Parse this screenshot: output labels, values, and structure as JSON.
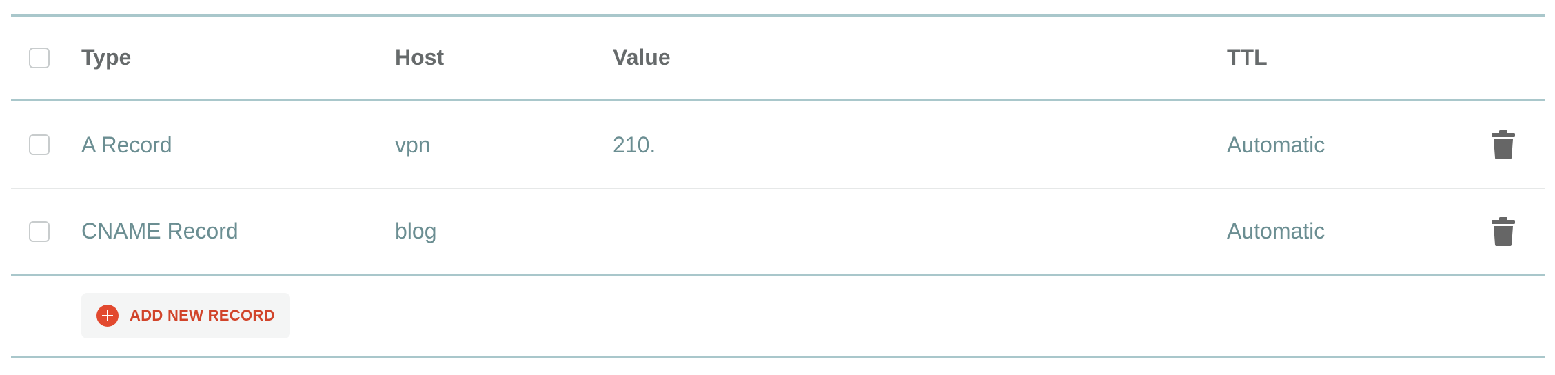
{
  "table": {
    "headers": {
      "type": "Type",
      "host": "Host",
      "value": "Value",
      "ttl": "TTL"
    },
    "rows": [
      {
        "type": "A Record",
        "host": "vpn",
        "value": "210.",
        "ttl": "Automatic"
      },
      {
        "type": "CNAME Record",
        "host": "blog",
        "value": "",
        "ttl": "Automatic"
      }
    ]
  },
  "actions": {
    "add_record_label": "ADD NEW RECORD"
  },
  "icons": {
    "delete": "trash-icon",
    "add": "plus-circle-icon"
  },
  "colors": {
    "accent_border": "#a9c7cb",
    "header_text": "#666a6b",
    "data_text": "#6b8e92",
    "add_button_text": "#d1442a",
    "add_icon": "#e2492f",
    "trash_icon": "#666666"
  }
}
